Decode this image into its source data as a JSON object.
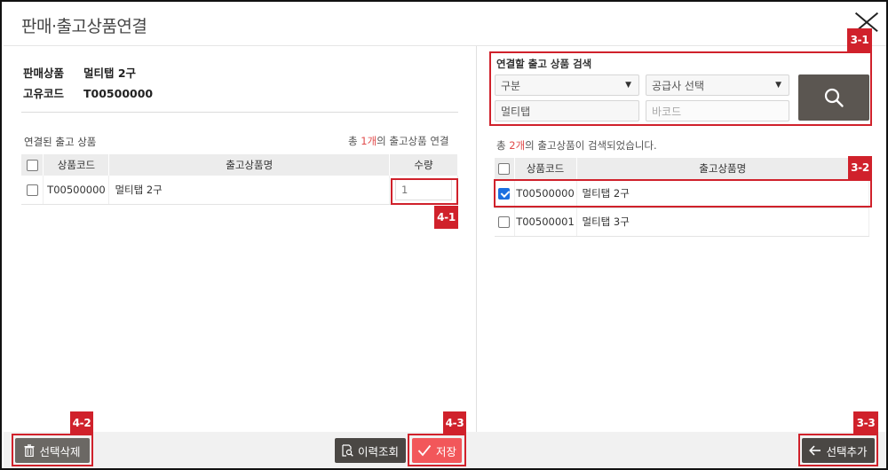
{
  "dialog": {
    "title": "판매·출고상품연결"
  },
  "left": {
    "sales_label": "판매상품",
    "sales_value": "멀티탭 2구",
    "code_label": "고유코드",
    "code_value": "T00500000",
    "linked_label": "연결된 출고 상품",
    "count_prefix": "총 ",
    "count_value": "1개",
    "count_suffix": "의 출고상품 연결",
    "columns": [
      "상품코드",
      "출고상품명",
      "수량"
    ],
    "rows": [
      {
        "code": "T00500000",
        "name": "멀티탭 2구",
        "qty": "1"
      }
    ]
  },
  "search": {
    "title": "연결할 출고 상품 검색",
    "category": "구분",
    "supplier": "공급사 선택",
    "name_value": "멀티탭",
    "barcode_placeholder": "바코드",
    "result_prefix": "총 ",
    "result_count": "2개",
    "result_suffix": "의 출고상품이 검색되었습니다.",
    "columns": [
      "상품코드",
      "출고상품명"
    ],
    "rows": [
      {
        "code": "T00500000",
        "name": "멀티탭 2구",
        "checked": true
      },
      {
        "code": "T00500001",
        "name": "멀티탭 3구",
        "checked": false
      }
    ]
  },
  "buttons": {
    "delete": "선택삭제",
    "history": "이력조회",
    "save": "저장",
    "add": "선택추가"
  },
  "annotations": {
    "a31": "3-1",
    "a32": "3-2",
    "a33": "3-3",
    "a41": "4-1",
    "a42": "4-2",
    "a43": "4-3"
  },
  "colors": {
    "annotation": "#d0212b",
    "accent_red": "#e14b4b",
    "save": "#f2575a",
    "search_btn": "#5b5651"
  }
}
